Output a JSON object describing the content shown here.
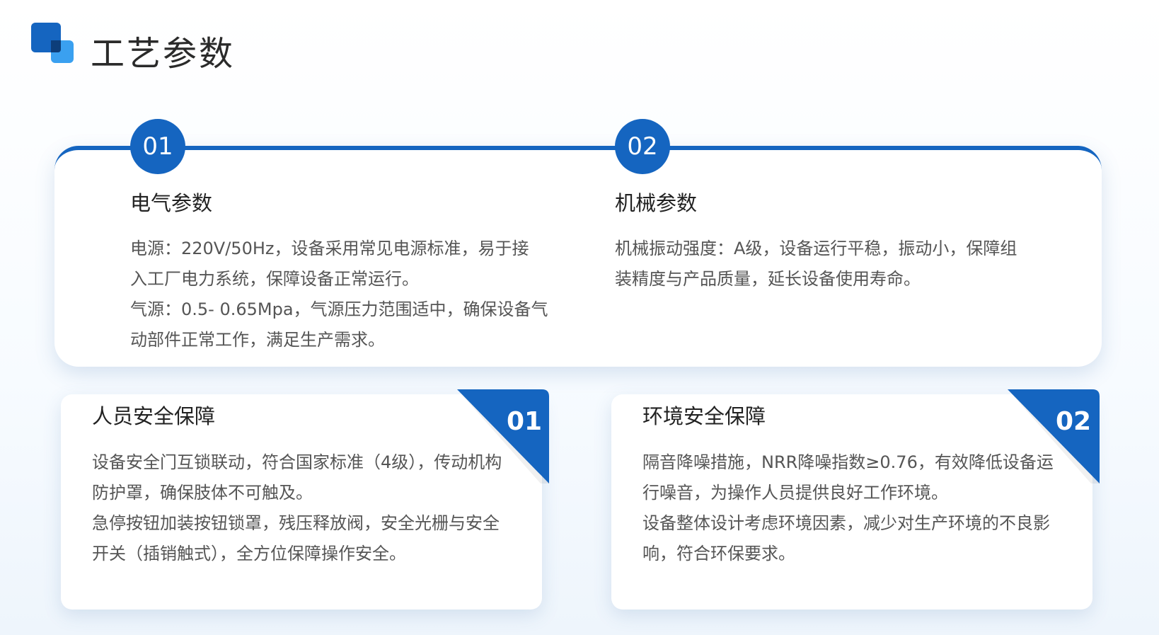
{
  "page": {
    "title": "工艺参数"
  },
  "top_section": {
    "items": [
      {
        "number": "01",
        "title": "电气参数",
        "lines": [
          "电源：220V/50Hz，设备采用常见电源标准，易于接",
          "入工厂电力系统，保障设备正常运行。",
          "气源：0.5- 0.65Mpa，气源压力范围适中，确保设备气",
          "动部件正常工作，满足生产需求。"
        ]
      },
      {
        "number": "02",
        "title": "机械参数",
        "lines": [
          "机械振动强度：A级，设备运行平稳，振动小，保障组",
          "装精度与产品质量，延长设备使用寿命。"
        ]
      }
    ]
  },
  "cards": [
    {
      "number": "01",
      "title": "人员安全保障",
      "lines": [
        "设备安全门互锁联动，符合国家标准（4级），传动机构",
        "防护罩，确保肢体不可触及。",
        "急停按钮加装按钮锁罩，残压释放阀，安全光栅与安全",
        "开关（插销触式），全方位保障操作安全。"
      ]
    },
    {
      "number": "02",
      "title": "环境安全保障",
      "lines": [
        "隔音降噪措施，NRR降噪指数≥0.76，有效降低设备运",
        "行噪音，为操作人员提供良好工作环境。",
        "设备整体设计考虑环境因素，减少对生产环境的不良影",
        "响，符合环保要求。"
      ]
    }
  ],
  "colors": {
    "accent": "#1565c0",
    "accent_light": "#3aa0f0"
  },
  "icons": {
    "logo": "stacked-squares-icon"
  }
}
